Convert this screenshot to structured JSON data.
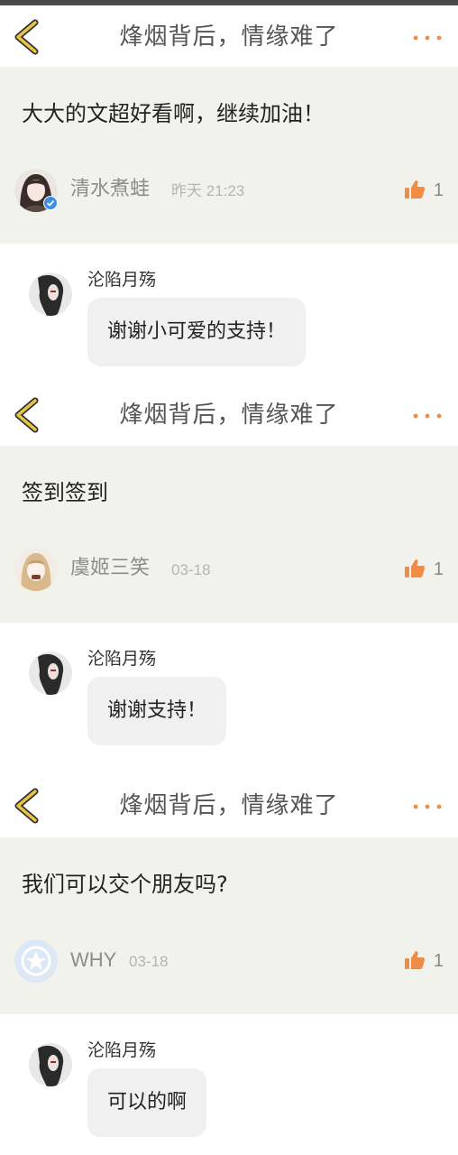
{
  "threads": [
    {
      "header": {
        "title": "烽烟背后，情缘难了"
      },
      "comment": {
        "text": "大大的文超好看啊，继续加油！",
        "username": "清水煮蛙",
        "time": "昨天 21:23",
        "likes": "1"
      },
      "reply": {
        "name": "沦陷月殇",
        "text": "谢谢小可爱的支持！"
      }
    },
    {
      "header": {
        "title": "烽烟背后，情缘难了"
      },
      "comment": {
        "text": "签到签到",
        "username": "虞姬三笑",
        "time": "03-18",
        "likes": "1"
      },
      "reply": {
        "name": "沦陷月殇",
        "text": "谢谢支持！"
      }
    },
    {
      "header": {
        "title": "烽烟背后，情缘难了"
      },
      "comment": {
        "text": "我们可以交个朋友吗?",
        "username": "WHY",
        "time": "03-18",
        "likes": "1"
      },
      "reply": {
        "name": "沦陷月殇",
        "text": "可以的啊"
      }
    }
  ],
  "colors": {
    "accent": "#f08c46",
    "back_arrow": "#e8c34a",
    "card_bg": "#f2f2ed",
    "verified": "#3b8fe6"
  },
  "icons": [
    "back-arrow-icon",
    "more-dots-icon",
    "thumbs-up-icon",
    "verified-badge-icon"
  ]
}
